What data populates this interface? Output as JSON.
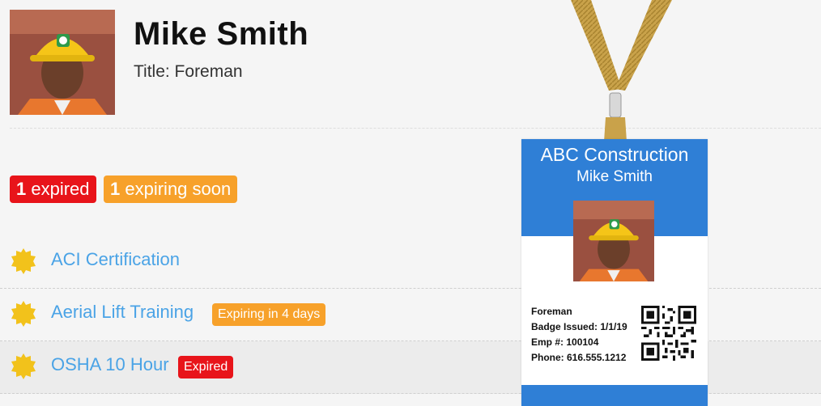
{
  "profile": {
    "name": "Mike Smith",
    "title": "Title: Foreman"
  },
  "summary": {
    "expired_count": "1",
    "expired_text": "expired",
    "soon_count": "1",
    "soon_text": "expiring soon"
  },
  "certifications": [
    {
      "name": "ACI Certification",
      "status": ""
    },
    {
      "name": "Aerial Lift Training",
      "status": "Expiring in 4 days"
    },
    {
      "name": "OSHA 10 Hour",
      "status": "Expired"
    }
  ],
  "badge": {
    "company": "ABC Construction",
    "person": "Mike Smith",
    "role": "Foreman",
    "issued": "Badge Issued: 1/1/19",
    "emp": "Emp #: 100104",
    "phone": "Phone: 616.555.1212"
  },
  "colors": {
    "expired": "#e8141a",
    "expiring": "#f7a12a",
    "link": "#4aa3e6",
    "badge_blue": "#2f7fd6",
    "seal": "#f2c21b"
  }
}
